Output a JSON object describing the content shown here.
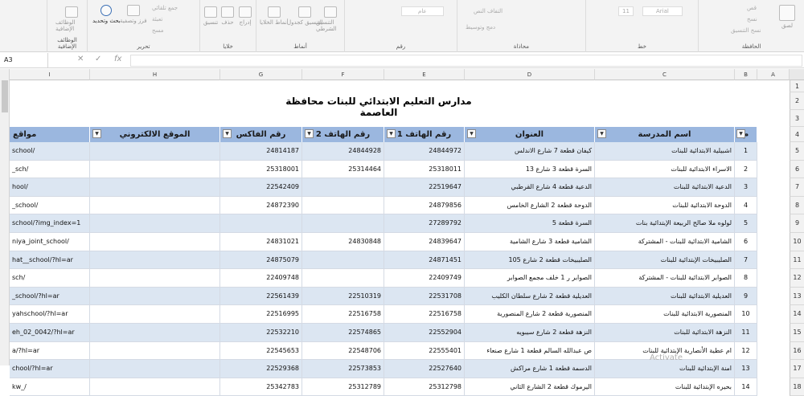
{
  "ribbon": {
    "groups": [
      {
        "key": "addins",
        "label": "الوظائف الإضافية",
        "buttons": [
          "الوظائف الإضافية"
        ]
      },
      {
        "key": "editing",
        "label": "تحرير",
        "buttons": [
          "بحث وتحديد",
          "فرز وتصفية"
        ],
        "extra": [
          "جمع تلقائي",
          "تعبئة",
          "مسح"
        ]
      },
      {
        "key": "cells",
        "label": "خلايا",
        "buttons": [
          "تنسيق",
          "حذف",
          "إدراج"
        ]
      },
      {
        "key": "styles",
        "label": "أنماط",
        "buttons": [
          "أنماط الخلايا",
          "التنسيق كجدول",
          "التنسيق الشرطي"
        ]
      },
      {
        "key": "number",
        "label": "رقم",
        "buttons": [
          "عام"
        ]
      },
      {
        "key": "alignment",
        "label": "محاذاة",
        "buttons": [
          "التفاف النص",
          "دمج وتوسيط"
        ]
      },
      {
        "key": "font",
        "label": "خط",
        "buttons": [
          "Arial",
          "11"
        ]
      },
      {
        "key": "clipboard",
        "label": "الحافظة",
        "buttons": [
          "لصق",
          "قص",
          "نسخ",
          "نسخ التنسيق"
        ]
      }
    ]
  },
  "formula_bar": {
    "name_box": "A3",
    "fx_label": "fx",
    "value": ""
  },
  "columns": [
    "I",
    "H",
    "G",
    "F",
    "E",
    "D",
    "C",
    "B",
    "A"
  ],
  "sheet": {
    "title": "مدارس التعليم الابتدائي للبنات محافظة العاصمة",
    "headers": [
      "مواقع",
      "الموقع الالكتروني",
      "رقم الفاكس",
      "رقم الهاتف 2",
      "رقم الهاتف 1",
      "العنوان",
      "اسم المدرسة",
      "م"
    ],
    "rows": [
      {
        "rownum": "5",
        "m": "1",
        "name": "اشبيلية الابتدائية للبنات",
        "addr": "كيفان قطعة 7 شارع الاندلس",
        "tel1": "24844972",
        "tel2": "24844928",
        "fax": "24814187",
        "web": "",
        "site": "school/"
      },
      {
        "rownum": "6",
        "m": "2",
        "name": "الاسراء الابتدائية للبنات",
        "addr": "السرة قطعة 3 شارع 13",
        "tel1": "25318011",
        "tel2": "25314464",
        "fax": "25318001",
        "web": "",
        "site": "_sch/"
      },
      {
        "rownum": "7",
        "m": "3",
        "name": "الدعية الابتدائية للبنات",
        "addr": "الدعية قطعة 4 شارع القرطبي",
        "tel1": "22519647",
        "tel2": "",
        "fax": "22542409",
        "web": "",
        "site": "hool/"
      },
      {
        "rownum": "8",
        "m": "4",
        "name": "الدوحة الابتدائية للبنات",
        "addr": "الدوحة قطعة 2 الشارع الخامس",
        "tel1": "24879856",
        "tel2": "",
        "fax": "24872390",
        "web": "",
        "site": "_school/"
      },
      {
        "rownum": "9",
        "m": "5",
        "name": "لولوه ملا صالح الربيعة الإبتدائية بنات",
        "addr": "السرة قطعة 5",
        "tel1": "27289792",
        "tel2": "",
        "fax": "",
        "web": "",
        "site": "school/?img_index=1"
      },
      {
        "rownum": "10",
        "m": "6",
        "name": "الشامية الابتدائية للبنات - المشتركة",
        "addr": "الشامية قطعة 3 شارع الشامية",
        "tel1": "24839647",
        "tel2": "24830848",
        "fax": "24831021",
        "web": "",
        "site": "niya_joint_school/"
      },
      {
        "rownum": "11",
        "m": "7",
        "name": "الصليبيخات الإبتدائية للبنات",
        "addr": "الصليبيخات قطعة 2 شارع 105",
        "tel1": "24871451",
        "tel2": "",
        "fax": "24875079",
        "web": "",
        "site": "hat__school/?hl=ar"
      },
      {
        "rownum": "12",
        "m": "8",
        "name": "الصوابر الابتدائية للبنات - المشتركة",
        "addr": "الصوابر ر 1 خلف مجمع الصوابر",
        "tel1": "22409749",
        "tel2": "",
        "fax": "22409748",
        "web": "",
        "site": "sch/"
      },
      {
        "rownum": "13",
        "m": "9",
        "name": "العديلية الابتدائية للبنات",
        "addr": "العديلية قطعة 2 شارع سلطان الكليب",
        "tel1": "22531708",
        "tel2": "22510319",
        "fax": "22561439",
        "web": "",
        "site": "_school/?hl=ar"
      },
      {
        "rownum": "14",
        "m": "10",
        "name": "المنصورية الابتدائية للبنات",
        "addr": "المنصورية قطعة 2 شارع المنصورية",
        "tel1": "22516758",
        "tel2": "22516758",
        "fax": "22516995",
        "web": "",
        "site": "yahschool/?hl=ar"
      },
      {
        "rownum": "15",
        "m": "11",
        "name": "النزهة الابتدائية للبنات",
        "addr": "النزهة قطعة 2 شارع سيبويه",
        "tel1": "22552904",
        "tel2": "22574865",
        "fax": "22532210",
        "web": "",
        "site": "eh_02_0042/?hl=ar"
      },
      {
        "rownum": "16",
        "m": "12",
        "name": "ام عطية الأنصارية الإبتدائية للبنات",
        "addr": "ص عبدالله السالم قطعة 1 شارع صنعاء",
        "tel1": "22555401",
        "tel2": "22548706",
        "fax": "22545653",
        "web": "",
        "site": "a/?hl=ar"
      },
      {
        "rownum": "17",
        "m": "13",
        "name": "امنة الإبتدائية للبنات",
        "addr": "الدسمة قطعة 1 شارع مراكش",
        "tel1": "22527640",
        "tel2": "22573853",
        "fax": "22529368",
        "web": "",
        "site": "chool/?hl=ar"
      },
      {
        "rownum": "18",
        "m": "14",
        "name": "بحيره الإبتدائية للبنات",
        "addr": "اليرموك قطعة 2 الشارع الثاني",
        "tel1": "25312798",
        "tel2": "25312789",
        "fax": "25342783",
        "web": "",
        "site": "kw_/"
      }
    ],
    "top_rows": [
      "1",
      "2",
      "3",
      "4"
    ]
  },
  "watermark": "Activate",
  "colors": {
    "header_fill": "#9bb7df",
    "band_fill": "#dce6f2"
  }
}
